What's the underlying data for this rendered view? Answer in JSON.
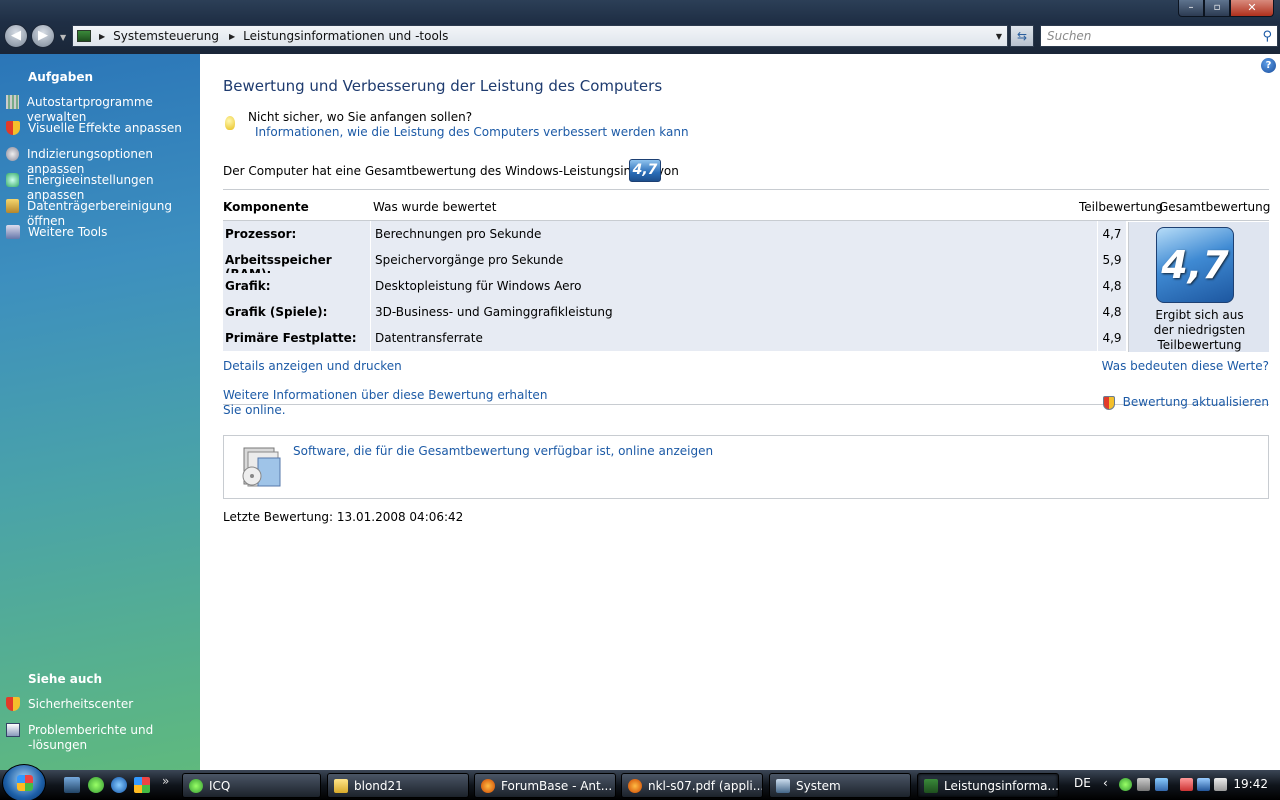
{
  "window": {
    "breadcrumb": [
      "Systemsteuerung",
      "Leistungsinformationen und -tools"
    ],
    "search_placeholder": "Suchen"
  },
  "sidebar": {
    "tasks_heading": "Aufgaben",
    "tasks": [
      {
        "label": "Autostartprogramme verwalten",
        "icon": "startup-icon"
      },
      {
        "label": "Visuelle Effekte anpassen",
        "icon": "shield-icon"
      },
      {
        "label": "Indizierungsoptionen anpassen",
        "icon": "indexing-icon"
      },
      {
        "label": "Energieeinstellungen anpassen",
        "icon": "power-icon"
      },
      {
        "label": "Datenträgerbereinigung öffnen",
        "icon": "disk-cleanup-icon"
      },
      {
        "label": "Weitere Tools",
        "icon": "tools-icon"
      }
    ],
    "see_also_heading": "Siehe auch",
    "see_also": [
      {
        "label": "Sicherheitscenter",
        "icon": "shield-icon"
      },
      {
        "label": "Problemberichte und",
        "label2": "-lösungen",
        "icon": "problem-reports-icon"
      }
    ]
  },
  "main": {
    "title": "Bewertung und Verbesserung der Leistung des Computers",
    "hint_question": "Nicht sicher, wo Sie anfangen sollen?",
    "hint_link": "Informationen, wie die Leistung des Computers verbessert werden kann",
    "overall_text": "Der Computer hat eine Gesamtbewertung des Windows-Leistungsindex von",
    "overall_score": "4,7",
    "table": {
      "col_component": "Komponente",
      "col_rated": "Was wurde bewertet",
      "col_subscore": "Teilbewertung",
      "col_basescore": "Gesamtbewertung",
      "rows": [
        {
          "component": "Prozessor:",
          "rated": "Berechnungen pro Sekunde",
          "score": "4,7"
        },
        {
          "component": "Arbeitsspeicher (RAM):",
          "rated": "Speichervorgänge pro Sekunde",
          "score": "5,9"
        },
        {
          "component": "Grafik:",
          "rated": "Desktopleistung für Windows Aero",
          "score": "4,8"
        },
        {
          "component": "Grafik (Spiele):",
          "rated": "3D-Business- und Gaminggrafikleistung",
          "score": "4,8"
        },
        {
          "component": "Primäre Festplatte:",
          "rated": "Datentransferrate",
          "score": "4,9"
        }
      ],
      "base_score": "4,7",
      "base_caption": [
        "Ergibt sich aus",
        "der niedrigsten",
        "Teilbewertung"
      ]
    },
    "details_link": "Details anzeigen und drucken",
    "meaning_link": "Was bedeuten diese Werte?",
    "more_info_line1": "Weitere Informationen über diese Bewertung erhalten",
    "more_info_line2": "Sie online.",
    "update_link": "Bewertung aktualisieren",
    "software_link": "Software, die für die Gesamtbewertung verfügbar ist, online anzeigen",
    "last_rating": "Letzte Bewertung: 13.01.2008 04:06:42"
  },
  "taskbar": {
    "tasks": [
      {
        "label": "ICQ",
        "icon": "icq-icon"
      },
      {
        "label": "blond21",
        "icon": "folder-icon"
      },
      {
        "label": "ForumBase - Ant...",
        "icon": "firefox-icon"
      },
      {
        "label": "nkl-s07.pdf (appli...",
        "icon": "firefox-icon"
      },
      {
        "label": "System",
        "icon": "system-icon"
      },
      {
        "label": "Leistungsinforma...",
        "icon": "control-panel-icon",
        "active": true
      }
    ],
    "language": "DE",
    "clock": "19:42"
  }
}
